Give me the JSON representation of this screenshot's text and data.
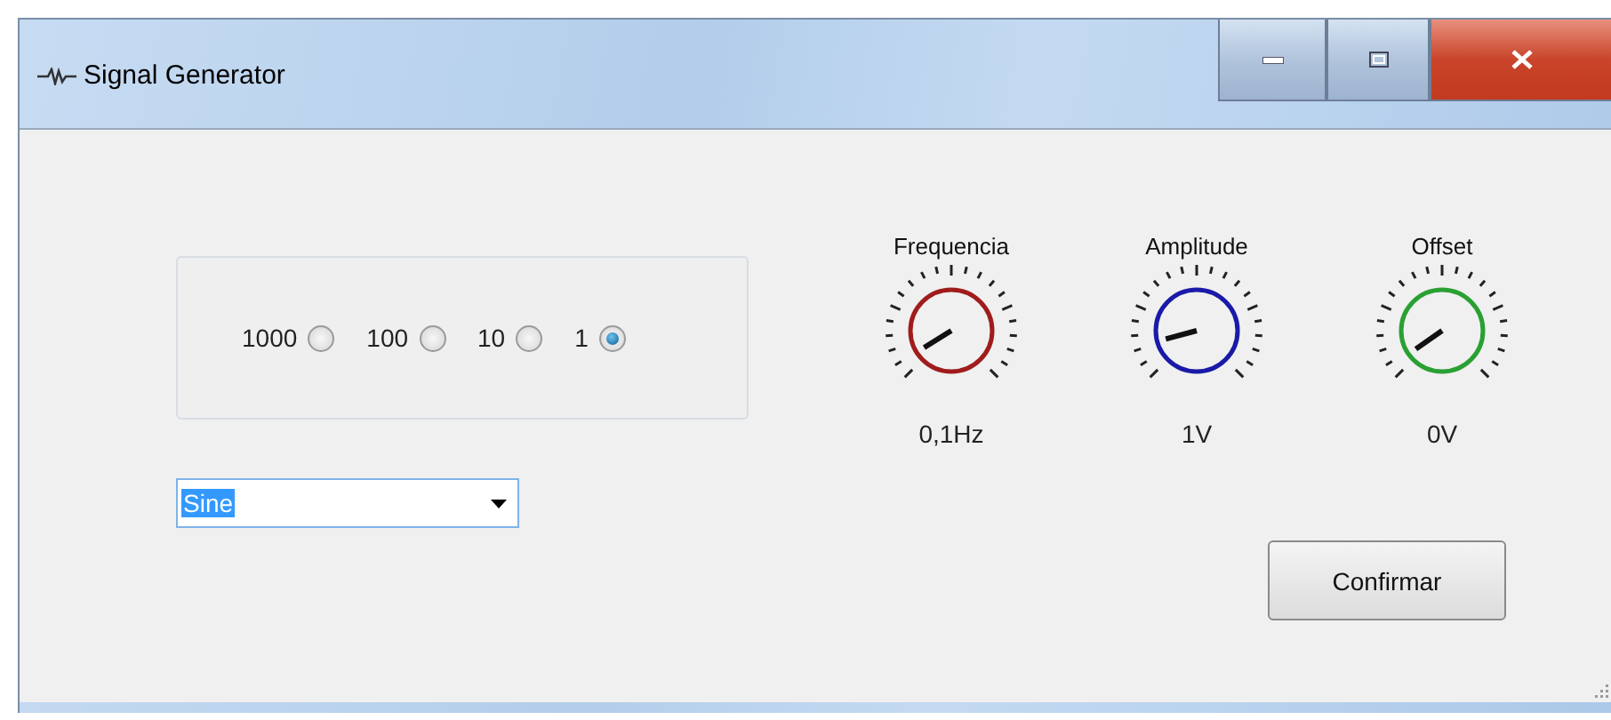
{
  "window": {
    "title": "Signal Generator"
  },
  "multiplier": [
    {
      "label": "1000",
      "selected": false
    },
    {
      "label": "100",
      "selected": false
    },
    {
      "label": "10",
      "selected": false
    },
    {
      "label": "1",
      "selected": true
    }
  ],
  "waveform": {
    "value": "Sine"
  },
  "knobs": [
    {
      "label": "Frequencia",
      "reading": "0,1Hz",
      "color": "#a01c1c"
    },
    {
      "label": "Amplitude",
      "reading": "1V",
      "color": "#1a1aa8"
    },
    {
      "label": "Offset",
      "reading": "0V",
      "color": "#2aa033"
    }
  ],
  "confirm_button": "Confirmar"
}
